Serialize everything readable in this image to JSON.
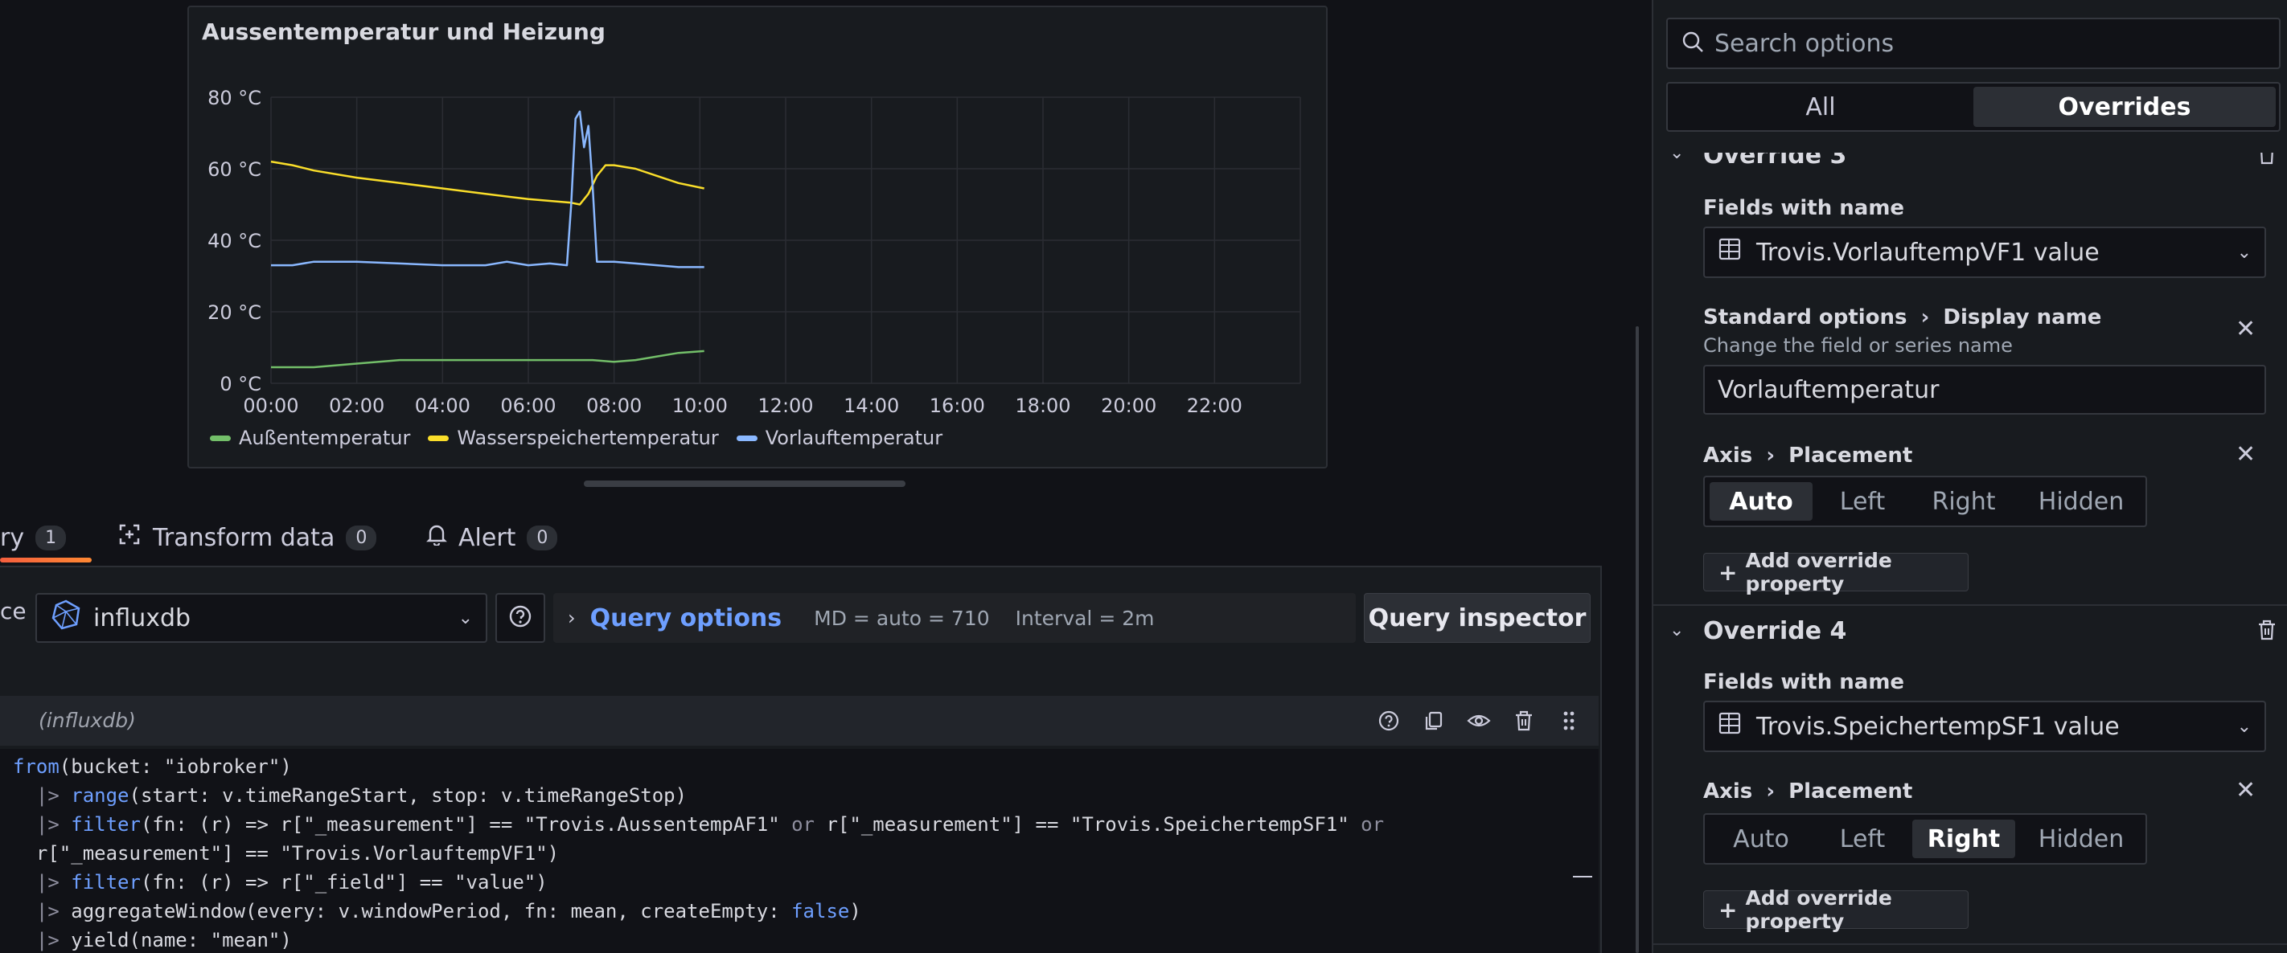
{
  "panel": {
    "title": "Aussentemperatur und Heizung",
    "legend": [
      {
        "name": "Außentemperatur",
        "color": "#73bf69"
      },
      {
        "name": "Wasserspeichertemperatur",
        "color": "#fade2a"
      },
      {
        "name": "Vorlauftemperatur",
        "color": "#8ab8ff"
      }
    ]
  },
  "chart_data": {
    "type": "line",
    "xlabel": "",
    "ylabel": "",
    "x_ticks": [
      "00:00",
      "02:00",
      "04:00",
      "06:00",
      "08:00",
      "10:00",
      "12:00",
      "14:00",
      "16:00",
      "18:00",
      "20:00",
      "22:00"
    ],
    "y_ticks": [
      "80 °C",
      "60 °C",
      "40 °C",
      "20 °C",
      "0 °C"
    ],
    "xlim_hours": [
      0,
      24
    ],
    "ylim": [
      0,
      80
    ],
    "grid": true,
    "legend_position": "bottom-left",
    "series": [
      {
        "name": "Außentemperatur",
        "color": "#73bf69",
        "x": [
          0,
          1,
          2,
          3,
          4,
          5,
          6,
          7,
          7.5,
          8,
          8.5,
          9,
          9.5,
          10.1
        ],
        "y": [
          4.5,
          4.5,
          5.5,
          6.5,
          6.5,
          6.5,
          6.5,
          6.5,
          6.5,
          6,
          6.5,
          7.5,
          8.5,
          9
        ]
      },
      {
        "name": "Wasserspeichertemperatur",
        "color": "#fade2a",
        "x": [
          0,
          0.5,
          1,
          2,
          3,
          4,
          5,
          6,
          7,
          7.2,
          7.4,
          7.6,
          7.8,
          8,
          8.5,
          9,
          9.5,
          10.1
        ],
        "y": [
          62,
          61,
          59.5,
          57.5,
          56,
          54.5,
          53,
          51.5,
          50.5,
          50,
          53,
          58,
          61,
          61,
          60,
          58,
          56,
          54.5
        ]
      },
      {
        "name": "Vorlauftemperatur",
        "color": "#8ab8ff",
        "x": [
          0,
          0.5,
          1,
          2,
          3,
          4,
          5,
          5.5,
          6,
          6.5,
          6.9,
          7,
          7.1,
          7.2,
          7.3,
          7.4,
          7.5,
          7.6,
          7.7,
          7.8,
          8,
          8.5,
          9,
          9.5,
          10.1
        ],
        "y": [
          33,
          33,
          34,
          34,
          33.5,
          33,
          33,
          34,
          33,
          33.5,
          33,
          50,
          74,
          76,
          66,
          72,
          55,
          34,
          34,
          34,
          34,
          33.5,
          33,
          32.5,
          32.5
        ]
      }
    ]
  },
  "tabs": [
    {
      "label": "ry",
      "badge": "1"
    },
    {
      "label": "Transform data",
      "badge": "0"
    },
    {
      "label": "Alert",
      "badge": "0"
    }
  ],
  "query": {
    "datasource_label": "ce",
    "datasource": "influxdb",
    "options_title": "Query options",
    "md": "MD = auto = 710",
    "interval": "Interval = 2m",
    "inspector": "Query inspector",
    "row_name": "(influxdb)",
    "code_lines": [
      [
        {
          "t": "from",
          "c": "kw"
        },
        {
          "t": "(bucket: \"iobroker\")",
          "c": "str"
        }
      ],
      [
        {
          "t": "  |> ",
          "c": "op"
        },
        {
          "t": "range",
          "c": "kw"
        },
        {
          "t": "(start: v.timeRangeStart, stop: v.timeRangeStop)",
          "c": "str"
        }
      ],
      [
        {
          "t": "  |> ",
          "c": "op"
        },
        {
          "t": "filter",
          "c": "kw"
        },
        {
          "t": "(fn: (r) => r[\"_measurement\"] == \"Trovis.AussentempAF1\" ",
          "c": "str"
        },
        {
          "t": "or",
          "c": "op"
        },
        {
          "t": " r[\"_measurement\"] == \"Trovis.SpeichertempSF1\" ",
          "c": "str"
        },
        {
          "t": "or",
          "c": "op"
        }
      ],
      [
        {
          "t": "  r[\"_measurement\"] == \"Trovis.VorlauftempVF1\")",
          "c": "str"
        }
      ],
      [
        {
          "t": "  |> ",
          "c": "op"
        },
        {
          "t": "filter",
          "c": "kw"
        },
        {
          "t": "(fn: (r) => r[\"_field\"] == \"value\")",
          "c": "str"
        }
      ],
      [
        {
          "t": "  |> ",
          "c": "op"
        },
        {
          "t": "aggregateWindow(every: v.windowPeriod, fn: mean, createEmpty: ",
          "c": "str"
        },
        {
          "t": "false",
          "c": "kw"
        },
        {
          "t": ")",
          "c": "str"
        }
      ],
      [
        {
          "t": "  |> ",
          "c": "op"
        },
        {
          "t": "yield(name: \"mean\")",
          "c": "str"
        }
      ]
    ]
  },
  "options": {
    "search_placeholder": "Search options",
    "seg_all": "All",
    "seg_overrides": "Overrides",
    "override3": {
      "title": "Override 3",
      "fields_label": "Fields with name",
      "field": "Trovis.VorlauftempVF1 value",
      "std_label": "Standard options",
      "display_name_label": "Display name",
      "display_name_desc": "Change the field or series name",
      "display_name_value": "Vorlauftemperatur",
      "axis_label": "Axis",
      "placement_label": "Placement",
      "placement_options": [
        "Auto",
        "Left",
        "Right",
        "Hidden"
      ],
      "placement_selected": "Auto",
      "add_label": "Add override property"
    },
    "override4": {
      "title": "Override 4",
      "fields_label": "Fields with name",
      "field": "Trovis.SpeichertempSF1 value",
      "axis_label": "Axis",
      "placement_label": "Placement",
      "placement_options": [
        "Auto",
        "Left",
        "Right",
        "Hidden"
      ],
      "placement_selected": "Right",
      "add_label": "Add override property"
    }
  }
}
